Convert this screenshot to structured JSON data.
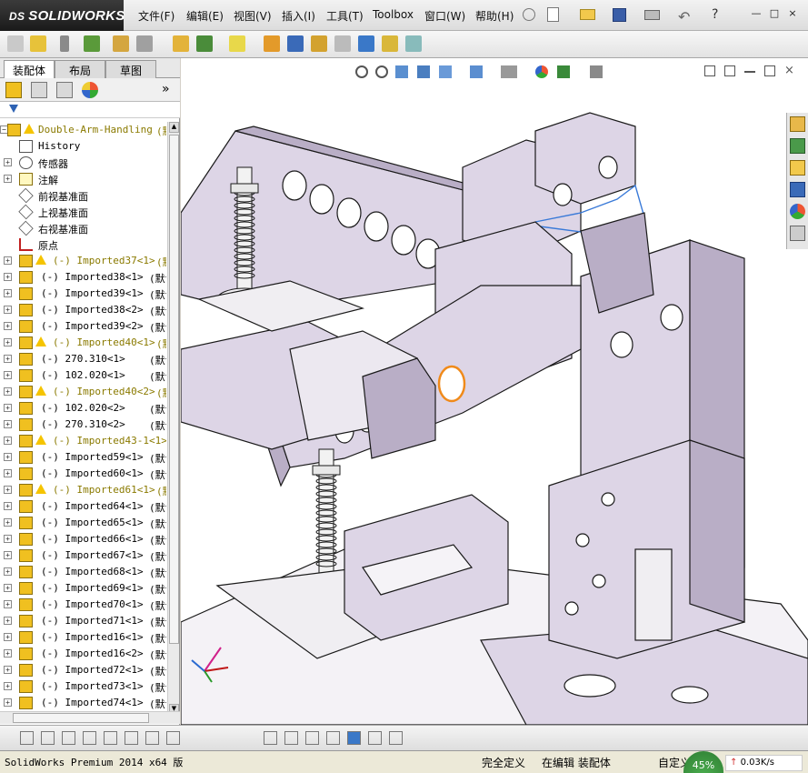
{
  "app": {
    "title": "SOLIDWORKS",
    "brand_color": "#c8102e"
  },
  "menu": [
    "文件(F)",
    "编辑(E)",
    "视图(V)",
    "插入(I)",
    "工具(T)",
    "Toolbox",
    "窗口(W)",
    "帮助(H)"
  ],
  "window_controls": [
    "—",
    "□",
    "×"
  ],
  "left_tabs": [
    "装配体",
    "布局",
    "草图"
  ],
  "tree": {
    "root": "Double-Arm-Handling",
    "root_suffix": "(默",
    "items": [
      {
        "label": "History",
        "kind": "history"
      },
      {
        "label": "传感器",
        "kind": "sensor"
      },
      {
        "label": "注解",
        "kind": "annotation"
      },
      {
        "label": "前视基准面",
        "kind": "plane"
      },
      {
        "label": "上视基准面",
        "kind": "plane"
      },
      {
        "label": "右视基准面",
        "kind": "plane"
      },
      {
        "label": "原点",
        "kind": "origin"
      },
      {
        "label": "(-) Imported37<1>",
        "suffix": "(默",
        "warn": true
      },
      {
        "label": "(-) Imported38<1>",
        "suffix": "(默认"
      },
      {
        "label": "(-) Imported39<1>",
        "suffix": "(默认"
      },
      {
        "label": "(-) Imported38<2>",
        "suffix": "(默认"
      },
      {
        "label": "(-) Imported39<2>",
        "suffix": "(默认"
      },
      {
        "label": "(-) Imported40<1>",
        "suffix": "(默",
        "warn": true
      },
      {
        "label": "(-) 270.310<1>",
        "suffix": "(默认<<默"
      },
      {
        "label": "(-) 102.020<1>",
        "suffix": "(默认<<默"
      },
      {
        "label": "(-) Imported40<2>",
        "suffix": "(默",
        "warn": true
      },
      {
        "label": "(-) 102.020<2>",
        "suffix": "(默认<<默"
      },
      {
        "label": "(-) 270.310<2>",
        "suffix": "(默认<<默"
      },
      {
        "label": "(-) Imported43-1<1>",
        "suffix": "",
        "warn": true
      },
      {
        "label": "(-) Imported59<1>",
        "suffix": "(默认"
      },
      {
        "label": "(-) Imported60<1>",
        "suffix": "(默认"
      },
      {
        "label": "(-) Imported61<1>",
        "suffix": "(默",
        "warn": true
      },
      {
        "label": "(-) Imported64<1>",
        "suffix": "(默认"
      },
      {
        "label": "(-) Imported65<1>",
        "suffix": "(默认"
      },
      {
        "label": "(-) Imported66<1>",
        "suffix": "(默认"
      },
      {
        "label": "(-) Imported67<1>",
        "suffix": "(默认"
      },
      {
        "label": "(-) Imported68<1>",
        "suffix": "(默认"
      },
      {
        "label": "(-) Imported69<1>",
        "suffix": "(默认"
      },
      {
        "label": "(-) Imported70<1>",
        "suffix": "(默认"
      },
      {
        "label": "(-) Imported71<1>",
        "suffix": "(默认"
      },
      {
        "label": "(-) Imported16<1>",
        "suffix": "(默认"
      },
      {
        "label": "(-) Imported16<2>",
        "suffix": "(默认"
      },
      {
        "label": "(-) Imported72<1>",
        "suffix": "(默认"
      },
      {
        "label": "(-) Imported73<1>",
        "suffix": "(默认"
      },
      {
        "label": "(-) Imported74<1>",
        "suffix": "(默认"
      }
    ]
  },
  "status": {
    "product": "SolidWorks Premium 2014 x64 版",
    "definition": "完全定义",
    "editing": "在编辑 装配体",
    "custom": "自定义",
    "percent": "45%",
    "net": "0.03K/s"
  },
  "colors": {
    "part_face": "#ddd5e6",
    "part_shadow": "#b9aec6",
    "edge": "#1a1a1a",
    "selected": "#f08a1a",
    "warn": "#f5c400"
  }
}
